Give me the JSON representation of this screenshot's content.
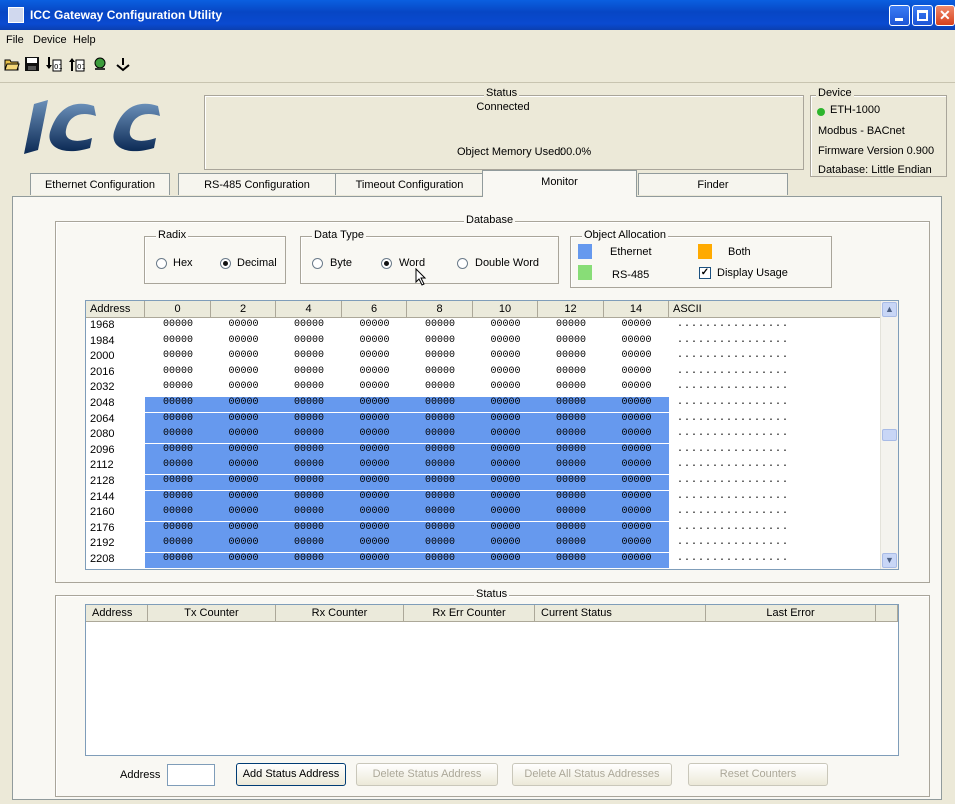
{
  "window": {
    "title": "ICC Gateway Configuration Utility"
  },
  "menu": {
    "items": [
      "File",
      "Device",
      "Help"
    ]
  },
  "logo_text": "ICC",
  "status_panel": {
    "title": "Status",
    "connection": "Connected",
    "memory_label": "Object Memory Used:",
    "memory_value": "00.0%"
  },
  "device_panel": {
    "title": "Device",
    "name": "ETH-1000",
    "protocol": "Modbus - BACnet",
    "firmware": "Firmware Version 0.900",
    "database": "Database: Little Endian",
    "status_color": "#2db52d"
  },
  "tabs": [
    "Ethernet Configuration",
    "RS-485 Configuration",
    "Timeout Configuration",
    "Monitor",
    "Finder"
  ],
  "database": {
    "title": "Database",
    "radix": {
      "title": "Radix",
      "options": [
        "Hex",
        "Decimal"
      ],
      "selected": "Decimal"
    },
    "data_type": {
      "title": "Data Type",
      "options": [
        "Byte",
        "Word",
        "Double Word"
      ],
      "selected": "Word"
    },
    "allocation": {
      "title": "Object Allocation",
      "ethernet": "Ethernet",
      "rs485": "RS-485",
      "both": "Both",
      "display_usage": "Display Usage",
      "display_usage_checked": true,
      "colors": {
        "ethernet": "#6699ee",
        "rs485": "#88dd77",
        "both": "#ffaa00"
      }
    },
    "columns": [
      "Address",
      "0",
      "2",
      "4",
      "6",
      "8",
      "10",
      "12",
      "14",
      "ASCII"
    ],
    "rows": [
      {
        "address": "1968",
        "values": [
          "00000",
          "00000",
          "00000",
          "00000",
          "00000",
          "00000",
          "00000",
          "00000"
        ],
        "ascii": "................",
        "alloc": false
      },
      {
        "address": "1984",
        "values": [
          "00000",
          "00000",
          "00000",
          "00000",
          "00000",
          "00000",
          "00000",
          "00000"
        ],
        "ascii": "................",
        "alloc": false
      },
      {
        "address": "2000",
        "values": [
          "00000",
          "00000",
          "00000",
          "00000",
          "00000",
          "00000",
          "00000",
          "00000"
        ],
        "ascii": "................",
        "alloc": false
      },
      {
        "address": "2016",
        "values": [
          "00000",
          "00000",
          "00000",
          "00000",
          "00000",
          "00000",
          "00000",
          "00000"
        ],
        "ascii": "................",
        "alloc": false
      },
      {
        "address": "2032",
        "values": [
          "00000",
          "00000",
          "00000",
          "00000",
          "00000",
          "00000",
          "00000",
          "00000"
        ],
        "ascii": "................",
        "alloc": false
      },
      {
        "address": "2048",
        "values": [
          "00000",
          "00000",
          "00000",
          "00000",
          "00000",
          "00000",
          "00000",
          "00000"
        ],
        "ascii": "................",
        "alloc": true
      },
      {
        "address": "2064",
        "values": [
          "00000",
          "00000",
          "00000",
          "00000",
          "00000",
          "00000",
          "00000",
          "00000"
        ],
        "ascii": "................",
        "alloc": true
      },
      {
        "address": "2080",
        "values": [
          "00000",
          "00000",
          "00000",
          "00000",
          "00000",
          "00000",
          "00000",
          "00000"
        ],
        "ascii": "................",
        "alloc": true
      },
      {
        "address": "2096",
        "values": [
          "00000",
          "00000",
          "00000",
          "00000",
          "00000",
          "00000",
          "00000",
          "00000"
        ],
        "ascii": "................",
        "alloc": true
      },
      {
        "address": "2112",
        "values": [
          "00000",
          "00000",
          "00000",
          "00000",
          "00000",
          "00000",
          "00000",
          "00000"
        ],
        "ascii": "................",
        "alloc": true
      },
      {
        "address": "2128",
        "values": [
          "00000",
          "00000",
          "00000",
          "00000",
          "00000",
          "00000",
          "00000",
          "00000"
        ],
        "ascii": "................",
        "alloc": true
      },
      {
        "address": "2144",
        "values": [
          "00000",
          "00000",
          "00000",
          "00000",
          "00000",
          "00000",
          "00000",
          "00000"
        ],
        "ascii": "................",
        "alloc": true
      },
      {
        "address": "2160",
        "values": [
          "00000",
          "00000",
          "00000",
          "00000",
          "00000",
          "00000",
          "00000",
          "00000"
        ],
        "ascii": "................",
        "alloc": true
      },
      {
        "address": "2176",
        "values": [
          "00000",
          "00000",
          "00000",
          "00000",
          "00000",
          "00000",
          "00000",
          "00000"
        ],
        "ascii": "................",
        "alloc": true
      },
      {
        "address": "2192",
        "values": [
          "00000",
          "00000",
          "00000",
          "00000",
          "00000",
          "00000",
          "00000",
          "00000"
        ],
        "ascii": "................",
        "alloc": true
      },
      {
        "address": "2208",
        "values": [
          "00000",
          "00000",
          "00000",
          "00000",
          "00000",
          "00000",
          "00000",
          "00000"
        ],
        "ascii": "................",
        "alloc": true
      }
    ]
  },
  "status_section": {
    "title": "Status",
    "columns": [
      "Address",
      "Tx Counter",
      "Rx Counter",
      "Rx Err Counter",
      "Current Status",
      "Last Error"
    ],
    "address_label": "Address",
    "address_value": "",
    "buttons": {
      "add": "Add Status Address",
      "delete": "Delete Status Address",
      "delete_all": "Delete All Status Addresses",
      "reset": "Reset Counters"
    }
  }
}
